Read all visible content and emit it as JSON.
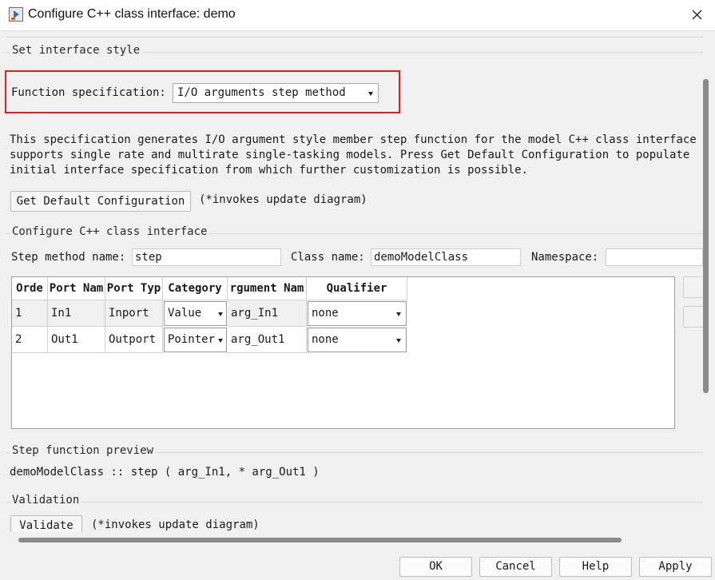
{
  "window": {
    "title": "Configure C++ class interface: demo"
  },
  "interface_style": {
    "group_title": "Set interface style",
    "function_spec_label": "Function specification:",
    "function_spec_value": "I/O arguments step method",
    "description_lines": [
      "This specification generates I/O argument style member step function for the model C++ class interface",
      "supports single rate and multirate single-tasking models.  Press Get Default Configuration to populate",
      "initial interface specification from which further customization is possible."
    ],
    "get_default_button": "Get Default Configuration",
    "get_default_note": "(*invokes update diagram)"
  },
  "class_interface": {
    "group_title": "Configure C++ class interface",
    "step_method_label": "Step method name:",
    "step_method_value": "step",
    "class_name_label": "Class name:",
    "class_name_value": "demoModelClass",
    "namespace_label": "Namespace:",
    "namespace_value": ""
  },
  "table": {
    "columns": [
      "Order",
      "Port Name",
      "Port Type",
      "Category",
      "Argument Name",
      "Qualifier"
    ],
    "columns_visible": [
      "Orde",
      "Port Nam",
      "Port Typ",
      "Category",
      "rgument Nam",
      "Qualifier"
    ],
    "rows": [
      {
        "order": "1",
        "port_name": "In1",
        "port_type": "Inport",
        "category": "Value",
        "argument_name": "arg_In1",
        "qualifier": "none"
      },
      {
        "order": "2",
        "port_name": "Out1",
        "port_type": "Outport",
        "category": "Pointer",
        "argument_name": "arg_Out1",
        "qualifier": "none"
      }
    ]
  },
  "preview": {
    "group_title": "Step function preview",
    "text": "demoModelClass :: step ( arg_In1, * arg_Out1 )"
  },
  "validation": {
    "group_title": "Validation",
    "button": "Validate",
    "note": "(*invokes update diagram)"
  },
  "footer": {
    "ok": "OK",
    "cancel": "Cancel",
    "help": "Help",
    "apply": "Apply"
  },
  "colors": {
    "highlight": "#e02020",
    "background": "#f0f0f0"
  },
  "icons": [
    "simulink-app-icon",
    "close-icon",
    "chevron-down-icon"
  ]
}
